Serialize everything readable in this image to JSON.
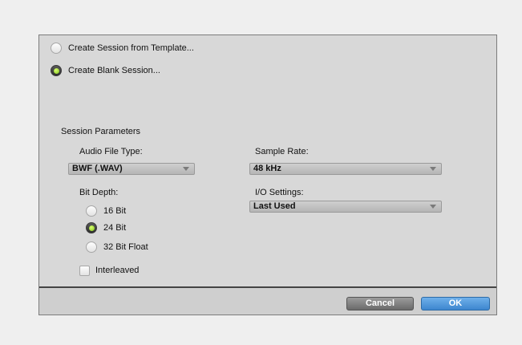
{
  "session_source": {
    "template_label": "Create Session from Template...",
    "blank_label": "Create Blank Session...",
    "selected": "blank"
  },
  "parameters": {
    "heading": "Session Parameters",
    "audio_file_type": {
      "label": "Audio File Type:",
      "value": "BWF (.WAV)"
    },
    "sample_rate": {
      "label": "Sample Rate:",
      "value": "48 kHz"
    },
    "bit_depth": {
      "label": "Bit Depth:",
      "options": [
        "16 Bit",
        "24 Bit",
        "32 Bit Float"
      ],
      "selected": "24 Bit"
    },
    "io_settings": {
      "label": "I/O Settings:",
      "value": "Last Used"
    },
    "interleaved": {
      "label": "Interleaved",
      "checked": false
    }
  },
  "buttons": {
    "cancel": "Cancel",
    "ok": "OK"
  }
}
